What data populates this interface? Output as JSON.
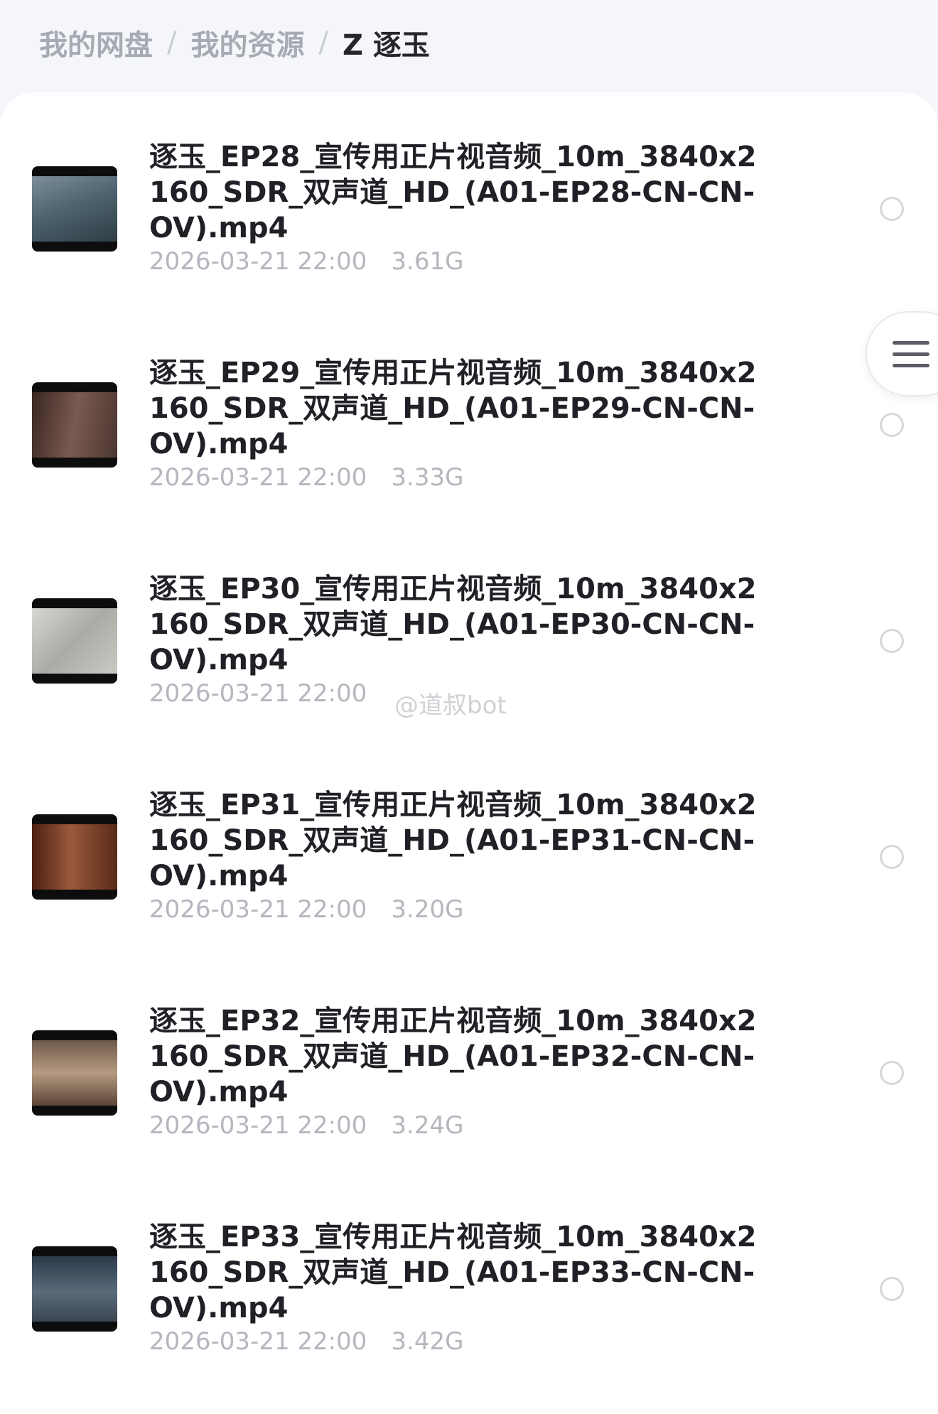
{
  "breadcrumb": {
    "items": [
      "我的网盘",
      "我的资源"
    ],
    "current": "Z 逐玉",
    "separator": "/"
  },
  "files": [
    {
      "title": "逐玉_EP28_宣传用正片视音频_10m_3840x2160_SDR_双声道_HD_(A01-EP28-CN-CN-OV).mp4",
      "date": "2026-03-21 22:00",
      "size": "3.61G"
    },
    {
      "title": "逐玉_EP29_宣传用正片视音频_10m_3840x2160_SDR_双声道_HD_(A01-EP29-CN-CN-OV).mp4",
      "date": "2026-03-21 22:00",
      "size": "3.33G"
    },
    {
      "title": "逐玉_EP30_宣传用正片视音频_10m_3840x2160_SDR_双声道_HD_(A01-EP30-CN-CN-OV).mp4",
      "date": "2026-03-21 22:00",
      "size": ""
    },
    {
      "title": "逐玉_EP31_宣传用正片视音频_10m_3840x2160_SDR_双声道_HD_(A01-EP31-CN-CN-OV).mp4",
      "date": "2026-03-21 22:00",
      "size": "3.20G"
    },
    {
      "title": "逐玉_EP32_宣传用正片视音频_10m_3840x2160_SDR_双声道_HD_(A01-EP32-CN-CN-OV).mp4",
      "date": "2026-03-21 22:00",
      "size": "3.24G"
    },
    {
      "title": "逐玉_EP33_宣传用正片视音频_10m_3840x2160_SDR_双声道_HD_(A01-EP33-CN-CN-OV).mp4",
      "date": "2026-03-21 22:00",
      "size": "3.42G"
    }
  ],
  "watermark": "@道叔bot",
  "icons": {
    "float_menu": "menu-icon",
    "select": "radio-circle-icon"
  },
  "colors": {
    "title": "#1f2126",
    "meta": "#b4b7be",
    "breadcrumb_inactive": "#a7aab2",
    "breadcrumb_current": "#24262b"
  }
}
